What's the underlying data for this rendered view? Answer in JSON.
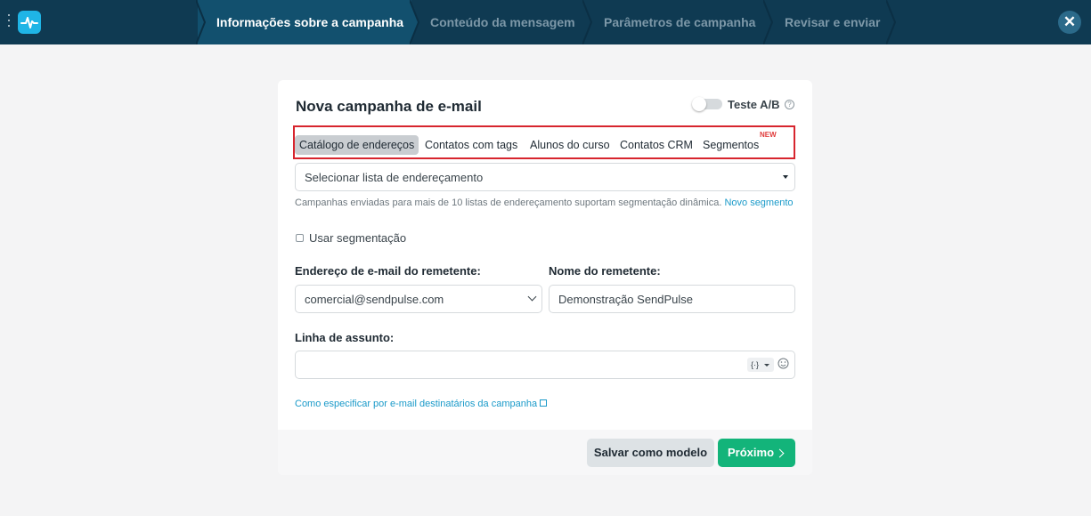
{
  "header": {
    "steps": [
      {
        "label": "Informações sobre a campanha",
        "active": true
      },
      {
        "label": "Conteúdo da mensagem",
        "active": false
      },
      {
        "label": "Parâmetros de campanha",
        "active": false
      },
      {
        "label": "Revisar e enviar",
        "active": false
      }
    ],
    "close_glyph": "✕"
  },
  "card": {
    "title": "Nova campanha de e-mail",
    "ab_test_label": "Teste A/B",
    "ab_test_enabled": false,
    "help_glyph": "?",
    "tabs": [
      {
        "label": "Catálogo de endereços",
        "active": true
      },
      {
        "label": "Contatos com tags",
        "active": false
      },
      {
        "label": "Alunos do curso",
        "active": false
      },
      {
        "label": "Contatos CRM",
        "active": false
      },
      {
        "label": "Segmentos",
        "active": false,
        "badge": "NEW"
      }
    ],
    "list_select_placeholder": "Selecionar lista de endereçamento",
    "hint_text": "Campanhas enviadas para mais de 10 listas de endereçamento suportam segmentação dinâmica.",
    "hint_link": "Novo segmento",
    "use_segmentation_label": "Usar segmentação",
    "use_segmentation_checked": false,
    "sender_email_label": "Endereço de e-mail do remetente:",
    "sender_email_value": "comercial@sendpulse.com",
    "sender_name_label": "Nome do remetente:",
    "sender_name_value": "Demonstração SendPulse",
    "subject_label": "Linha de assunto:",
    "subject_value": "",
    "variables_glyph": "{·}",
    "howto_link": "Como especificar por e-mail destinatários da campanha",
    "save_template_label": "Salvar como modelo",
    "next_label": "Próximo"
  },
  "colors": {
    "topbar": "#0f3a52",
    "active_step": "#12506e",
    "accent_link": "#1a9ac9",
    "primary_button": "#13b47a",
    "highlight_border": "#d7252e",
    "new_badge": "#e03b3b"
  },
  "icons": [
    "menu-dots-icon",
    "sendpulse-logo-icon",
    "close-icon",
    "help-icon",
    "caret-down-icon",
    "chevron-down-icon",
    "variables-icon",
    "emoji-icon",
    "external-link-icon",
    "chevron-right-icon"
  ]
}
